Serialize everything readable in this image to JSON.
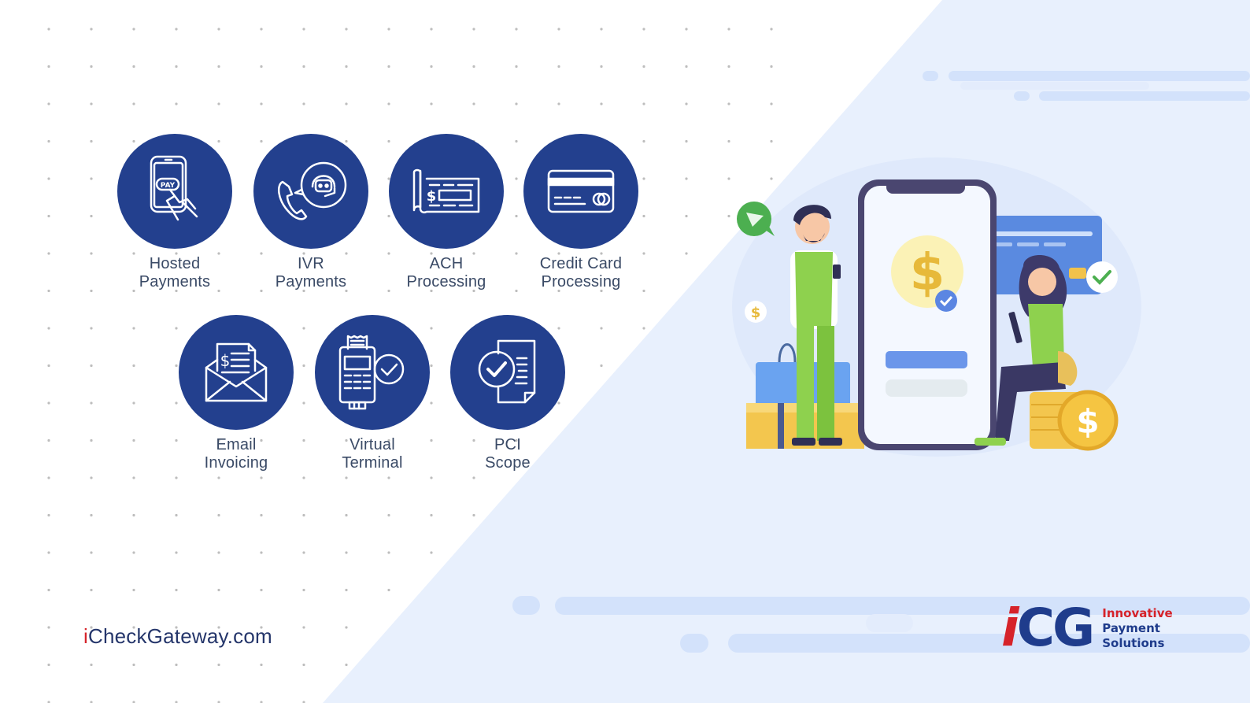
{
  "services": [
    {
      "id": "hosted-payments",
      "icon": "pay-phone-icon",
      "lines": [
        "Hosted",
        "Payments"
      ]
    },
    {
      "id": "ivr-payments",
      "icon": "ivr-phone-bot-icon",
      "lines": [
        "IVR",
        "Payments"
      ]
    },
    {
      "id": "ach-processing",
      "icon": "check-document-icon",
      "lines": [
        "ACH",
        "Processing"
      ]
    },
    {
      "id": "credit-card-processing",
      "icon": "credit-card-icon",
      "lines": [
        "Credit Card",
        "Processing"
      ]
    },
    {
      "id": "email-invoicing",
      "icon": "email-invoice-icon",
      "lines": [
        "Email",
        "Invoicing"
      ]
    },
    {
      "id": "virtual-terminal",
      "icon": "card-terminal-icon",
      "lines": [
        "Virtual",
        "Terminal"
      ]
    },
    {
      "id": "pci-scope",
      "icon": "compliance-document-icon",
      "lines": [
        "PCI",
        "Scope"
      ]
    }
  ],
  "footer": {
    "site_prefix": "i",
    "site_rest": "CheckGateway.com"
  },
  "logo": {
    "mark_i": "i",
    "mark_rest": "CG",
    "tagline": [
      "Innovative",
      "Payment",
      "Solutions"
    ]
  },
  "illustration": {
    "phone_symbol": "$",
    "coin_symbol": "$",
    "badge_symbol": "$"
  },
  "colors": {
    "brand_blue": "#23408e",
    "brand_red": "#d6232a",
    "bg_light_blue": "#e8f0fd"
  }
}
